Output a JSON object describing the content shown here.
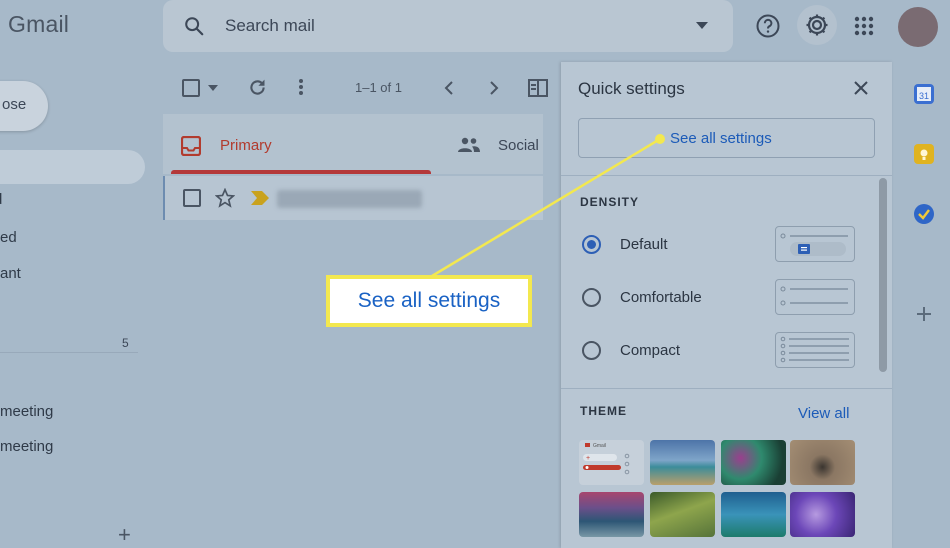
{
  "header": {
    "logo": "Gmail",
    "search_placeholder": "Search mail",
    "icons": [
      "search-icon",
      "dropdown-caret-icon",
      "help-icon",
      "gear-icon",
      "apps-grid-icon",
      "avatar"
    ]
  },
  "sidebar": {
    "compose_label": "ose",
    "items": [
      {
        "label": "d"
      },
      {
        "label": "ed"
      },
      {
        "label": "ant"
      },
      {
        "label": "5"
      },
      {
        "label": "meeting"
      },
      {
        "label": "meeting"
      }
    ],
    "add_label": "+"
  },
  "toolbar": {
    "range": "1–1 of 1"
  },
  "tabs": {
    "primary": "Primary",
    "social": "Social"
  },
  "quick_settings": {
    "title": "Quick settings",
    "see_all": "See all settings",
    "density_label": "DENSITY",
    "density_options": [
      {
        "label": "Default",
        "selected": true
      },
      {
        "label": "Comfortable",
        "selected": false
      },
      {
        "label": "Compact",
        "selected": false
      }
    ],
    "theme_label": "THEME",
    "view_all": "View all",
    "theme_tile_mini_label": "Gmail"
  },
  "callout": {
    "text": "See all settings",
    "border_color": "#f3e84f",
    "text_color": "#1a62c4"
  },
  "colors": {
    "accent_blue": "#1c5bb8",
    "primary_red": "#b23b2e",
    "overlay_bg": "#a7b9c9"
  }
}
